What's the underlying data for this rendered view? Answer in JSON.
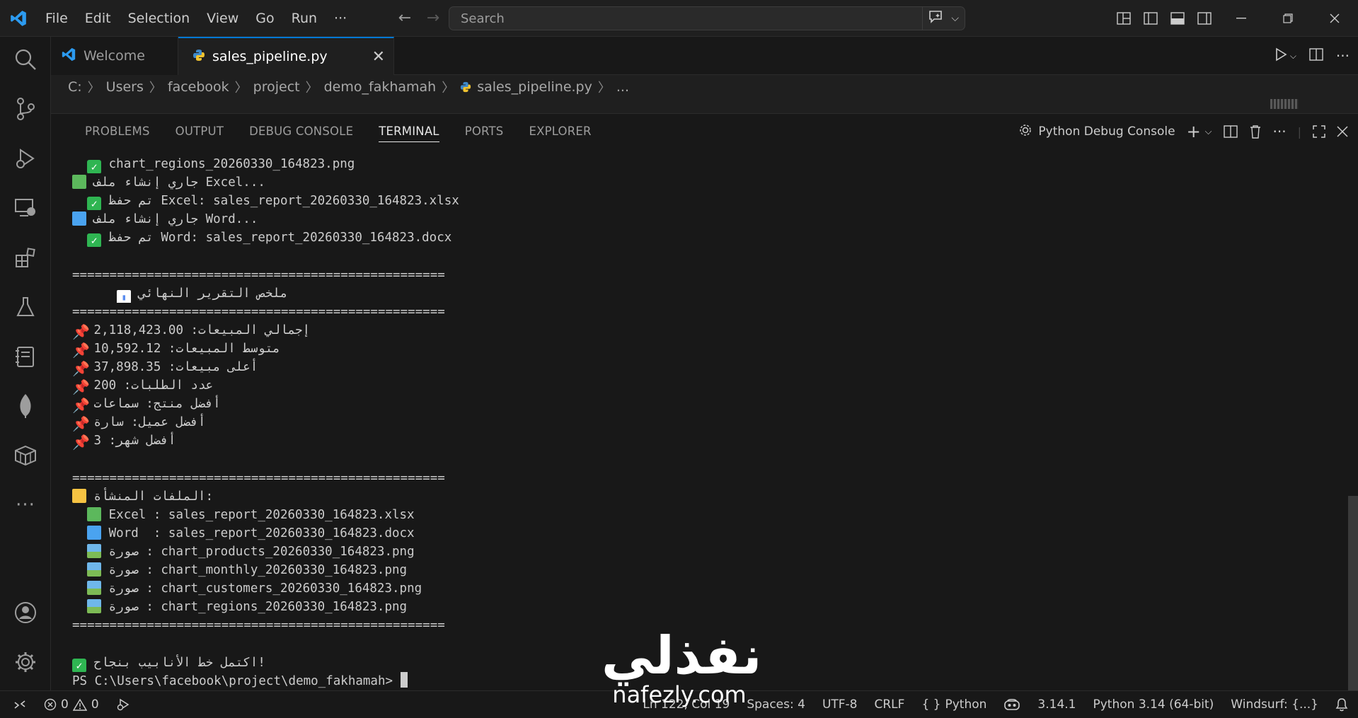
{
  "menu": [
    "File",
    "Edit",
    "Selection",
    "View",
    "Go",
    "Run",
    "···"
  ],
  "search": {
    "placeholder": "Search"
  },
  "tabs": [
    {
      "label": "Welcome",
      "icon": "vscode-logo-icon"
    },
    {
      "label": "sales_pipeline.py",
      "icon": "python-icon"
    }
  ],
  "breadcrumb": [
    "C:",
    "Users",
    "facebook",
    "project",
    "demo_fakhamah",
    "sales_pipeline.py",
    "..."
  ],
  "panel": {
    "tabs": [
      "PROBLEMS",
      "OUTPUT",
      "DEBUG CONSOLE",
      "TERMINAL",
      "PORTS",
      "EXPLORER"
    ],
    "active_tab": "TERMINAL",
    "profile": "Python Debug Console"
  },
  "terminal": [
    {
      "icon": "check",
      "indent": "  ",
      "text": "chart_regions_20260330_164823.png"
    },
    {
      "icon": "green-book",
      "indent": "",
      "text": "جاري إنشاء ملف Excel..."
    },
    {
      "icon": "check",
      "indent": "  ",
      "text": "تم حفظ Excel: sales_report_20260330_164823.xlsx"
    },
    {
      "icon": "blue-book",
      "indent": "",
      "text": "جاري إنشاء ملف Word..."
    },
    {
      "icon": "check",
      "indent": "  ",
      "text": "تم حفظ Word: sales_report_20260330_164823.docx"
    },
    {
      "icon": "",
      "indent": "",
      "text": ""
    },
    {
      "icon": "",
      "indent": "",
      "text": "=================================================="
    },
    {
      "icon": "bar-chart",
      "indent": "      ",
      "text": "ملخص التقرير النهائي"
    },
    {
      "icon": "",
      "indent": "",
      "text": "=================================================="
    },
    {
      "icon": "pin",
      "indent": "",
      "text": "إجمالي المبيعات: 2,118,423.00"
    },
    {
      "icon": "pin",
      "indent": "",
      "text": "متوسط المبيعات: 10,592.12"
    },
    {
      "icon": "pin",
      "indent": "",
      "text": "أعلى مبيعات: 37,898.35"
    },
    {
      "icon": "pin",
      "indent": "",
      "text": "عدد الطلبات: 200"
    },
    {
      "icon": "pin",
      "indent": "",
      "text": "أفضل منتج: سماعات"
    },
    {
      "icon": "pin",
      "indent": "",
      "text": "أفضل عميل: سارة"
    },
    {
      "icon": "pin",
      "indent": "",
      "text": "أفضل شهر: 3"
    },
    {
      "icon": "",
      "indent": "",
      "text": ""
    },
    {
      "icon": "",
      "indent": "",
      "text": "=================================================="
    },
    {
      "icon": "folder",
      "indent": "",
      "text": "الملفات المنشأة:"
    },
    {
      "icon": "green-book",
      "indent": "  ",
      "text": "Excel : sales_report_20260330_164823.xlsx"
    },
    {
      "icon": "blue-book",
      "indent": "  ",
      "text": "Word  : sales_report_20260330_164823.docx"
    },
    {
      "icon": "image",
      "indent": "  ",
      "text": "صورة : chart_products_20260330_164823.png"
    },
    {
      "icon": "image",
      "indent": "  ",
      "text": "صورة : chart_monthly_20260330_164823.png"
    },
    {
      "icon": "image",
      "indent": "  ",
      "text": "صورة : chart_customers_20260330_164823.png"
    },
    {
      "icon": "image",
      "indent": "  ",
      "text": "صورة : chart_regions_20260330_164823.png"
    },
    {
      "icon": "",
      "indent": "",
      "text": "=================================================="
    },
    {
      "icon": "",
      "indent": "",
      "text": ""
    },
    {
      "icon": "check",
      "indent": "",
      "text": "اكتمل خط الأنابيب بنجاح!"
    },
    {
      "icon": "",
      "indent": "",
      "text": "PS C:\\Users\\facebook\\project\\demo_fakhamah> ",
      "cursor": true
    }
  ],
  "status": {
    "errors": "0",
    "warnings": "0",
    "position": "Ln 122, Col 19",
    "spaces": "Spaces: 4",
    "encoding": "UTF-8",
    "eol": "CRLF",
    "language": "Python",
    "python_version": "3.14.1",
    "interpreter": "Python 3.14 (64-bit)",
    "windsurf": "Windsurf: {...}"
  },
  "watermark": {
    "arabic": "نفذلي",
    "latin": "nafezly.com"
  },
  "colors": {
    "accent": "#0078d4",
    "background": "#181818",
    "titlebar": "#1f1f1f",
    "text": "#cccccc"
  }
}
